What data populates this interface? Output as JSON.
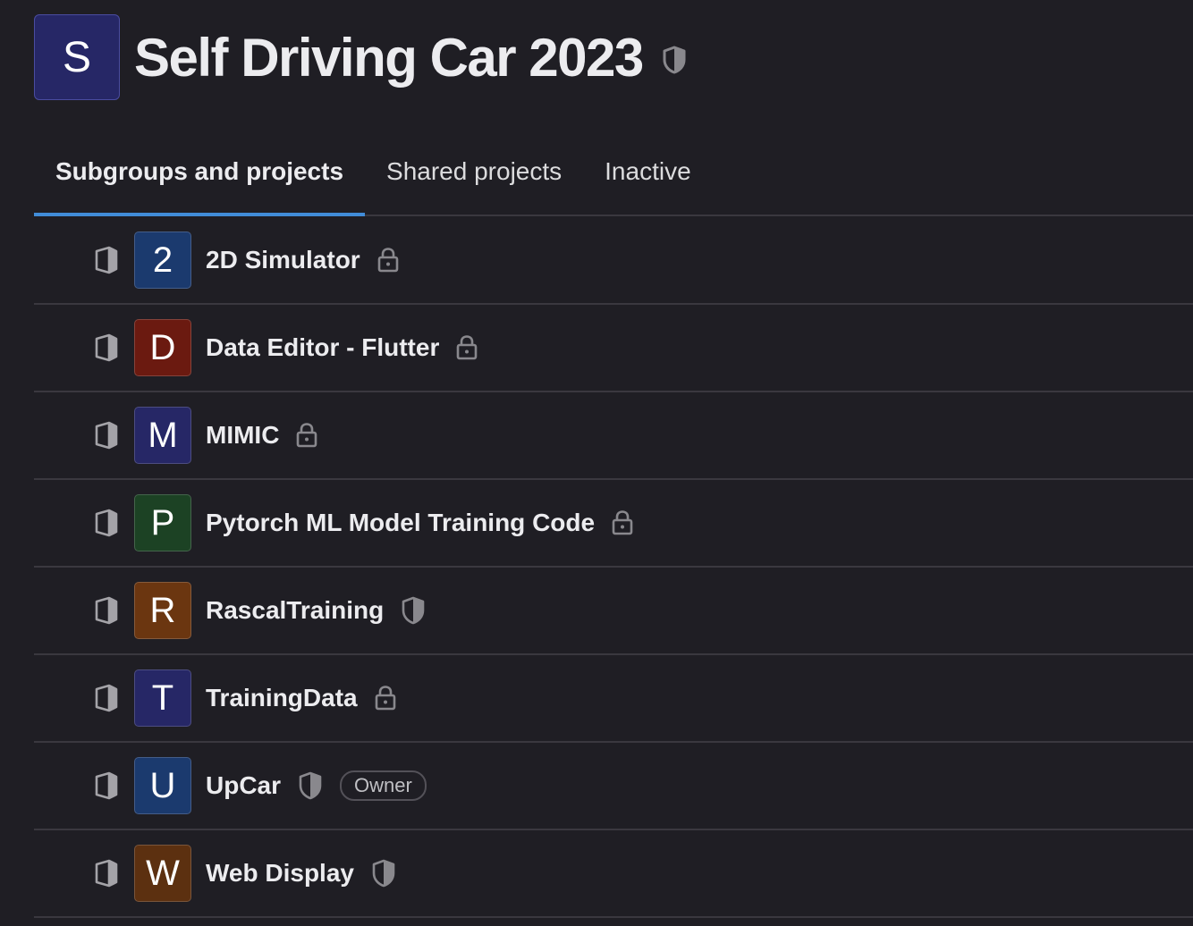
{
  "group": {
    "avatar_letter": "S",
    "title": "Self Driving Car 2023",
    "visibility_icon": "shield-icon"
  },
  "tabs": [
    {
      "label": "Subgroups and projects",
      "active": true
    },
    {
      "label": "Shared projects",
      "active": false
    },
    {
      "label": "Inactive",
      "active": false
    }
  ],
  "projects": [
    {
      "letter": "2",
      "name": "2D Simulator",
      "visibility": "lock",
      "color": "#1b3a6e",
      "badge": null
    },
    {
      "letter": "D",
      "name": "Data Editor - Flutter",
      "visibility": "lock",
      "color": "#6b1a10",
      "badge": null
    },
    {
      "letter": "M",
      "name": "MIMIC",
      "visibility": "lock",
      "color": "#262766",
      "badge": null
    },
    {
      "letter": "P",
      "name": "Pytorch ML Model Training Code",
      "visibility": "lock",
      "color": "#1c4224",
      "badge": null
    },
    {
      "letter": "R",
      "name": "RascalTraining",
      "visibility": "shield",
      "color": "#6b3610",
      "badge": null
    },
    {
      "letter": "T",
      "name": "TrainingData",
      "visibility": "lock",
      "color": "#262766",
      "badge": null
    },
    {
      "letter": "U",
      "name": "UpCar",
      "visibility": "shield",
      "color": "#1b3a6e",
      "badge": "Owner"
    },
    {
      "letter": "W",
      "name": "Web Display",
      "visibility": "shield",
      "color": "#5c3010",
      "badge": null
    }
  ]
}
